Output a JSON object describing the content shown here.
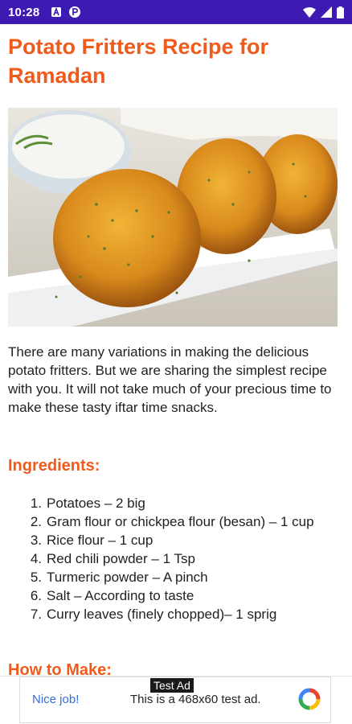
{
  "status_bar": {
    "time": "10:28",
    "background": "#3d1bb3"
  },
  "article": {
    "title": "Potato Fritters Recipe for Ramadan",
    "intro": "There are many variations in making the delicious potato fritters. But we are sharing the simplest recipe with you. It will not take much of your precious time to make these tasty iftar time snacks.",
    "ingredients_heading": "Ingredients:",
    "ingredients": [
      {
        "num": "1.",
        "text": "Potatoes – 2 big"
      },
      {
        "num": "2.",
        "text": "Gram flour or chickpea flour (besan) – 1 cup"
      },
      {
        "num": "3.",
        "text": "Rice flour – 1 cup"
      },
      {
        "num": "4.",
        "text": "Red chili powder – 1 Tsp"
      },
      {
        "num": "5.",
        "text": "Turmeric powder – A pinch"
      },
      {
        "num": "6.",
        "text": "Salt – According to taste"
      },
      {
        "num": "7.",
        "text": "Curry leaves (finely chopped)– 1 sprig"
      }
    ],
    "how_to_heading": "How to Make:",
    "accent_color": "#f05a1a"
  },
  "ad": {
    "badge": "Test Ad",
    "cta": "Nice job!",
    "description": "This is a 468x60 test ad."
  },
  "icons": [
    "notification-a-icon",
    "notification-p-icon",
    "wifi-icon",
    "signal-icon",
    "battery-icon",
    "dip-logo-icon"
  ]
}
